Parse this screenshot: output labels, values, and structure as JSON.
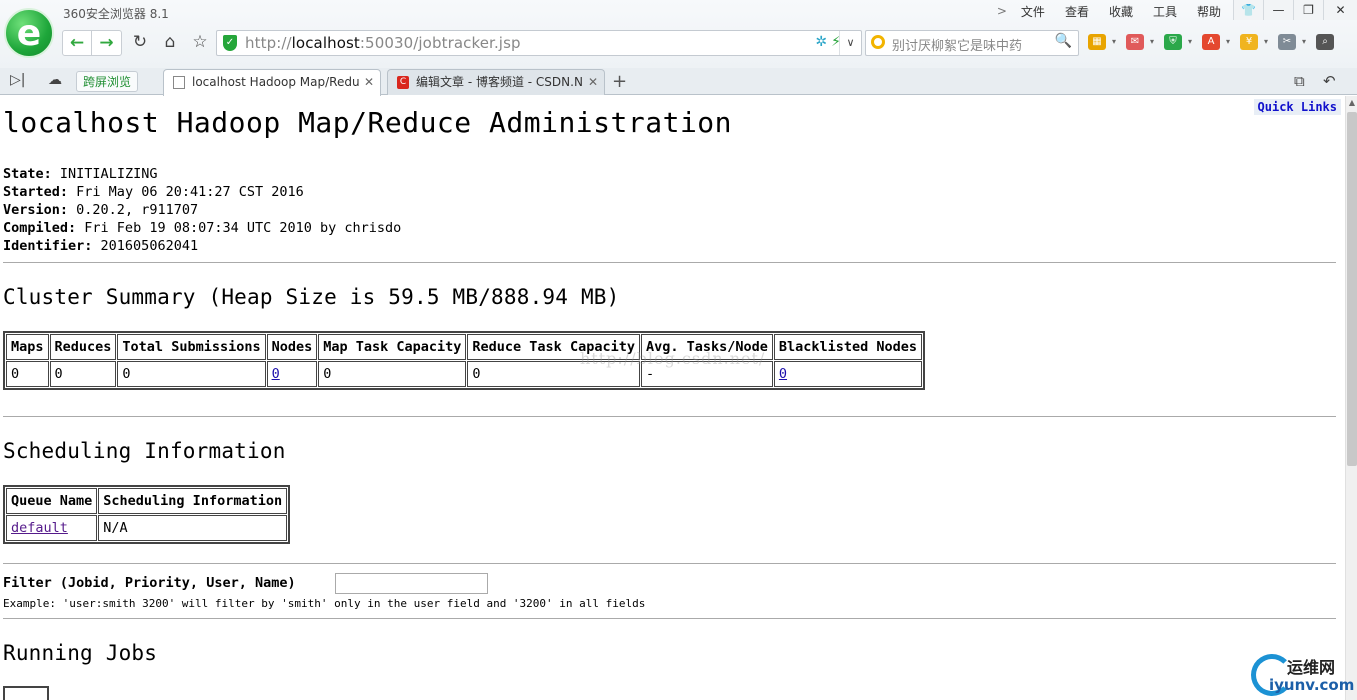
{
  "browser": {
    "title": "360安全浏览器 8.1",
    "logo_glyph": "e",
    "menu": [
      "文件",
      "查看",
      "收藏",
      "工具",
      "帮助"
    ],
    "menu_chevron": ">",
    "window_controls": {
      "skin": "👕",
      "minimize": "—",
      "maximize": "❐",
      "close": "✕"
    },
    "nav": {
      "back": "←",
      "forward": "→",
      "reload": "↻",
      "home": "⌂",
      "favorite": "☆"
    },
    "address": {
      "prefix": "http://",
      "host": "localhost",
      "rest": ":50030/jobtracker.jsp",
      "drop": "∨"
    },
    "search": {
      "placeholder": "别讨厌柳絮它是味中药",
      "glass": "🔍"
    },
    "extensions": [
      {
        "name": "apps",
        "glyph": "▦",
        "color": "#e8a400"
      },
      {
        "name": "mail",
        "glyph": "✉",
        "color": "#e05a5a"
      },
      {
        "name": "shield",
        "glyph": "⛨",
        "color": "#2ba84a"
      },
      {
        "name": "translate",
        "glyph": "A",
        "color": "#e4482f"
      },
      {
        "name": "wallet",
        "glyph": "¥",
        "color": "#f0b41f"
      },
      {
        "name": "screenshot",
        "glyph": "✂",
        "color": "#7f8b96"
      },
      {
        "name": "find",
        "glyph": "⌕",
        "color": "#555555"
      }
    ],
    "tabs": {
      "side_toggle": "▷|",
      "cloud": "☁",
      "split_label": "跨屏浏览",
      "items": [
        {
          "title": "localhost Hadoop Map/Redu",
          "active": true
        },
        {
          "title": "编辑文章 - 博客频道 - CSDN.N",
          "active": false
        }
      ],
      "close": "✕",
      "new_tab": "+",
      "restore": "⧉",
      "undo": "↶"
    }
  },
  "page": {
    "quick_links": "Quick Links",
    "title": "localhost Hadoop Map/Reduce Administration",
    "info": [
      {
        "label": "State:",
        "value": "INITIALIZING"
      },
      {
        "label": "Started:",
        "value": "Fri May 06 20:41:27 CST 2016"
      },
      {
        "label": "Version:",
        "value": "0.20.2, r911707"
      },
      {
        "label": "Compiled:",
        "value": "Fri Feb 19 08:07:34 UTC 2010 by chrisdo"
      },
      {
        "label": "Identifier:",
        "value": "201605062041"
      }
    ],
    "cluster_heading": "Cluster Summary (Heap Size is 59.5 MB/888.94 MB)",
    "cluster_table": {
      "headers": [
        "Maps",
        "Reduces",
        "Total Submissions",
        "Nodes",
        "Map Task Capacity",
        "Reduce Task Capacity",
        "Avg. Tasks/Node",
        "Blacklisted Nodes"
      ],
      "row": [
        "0",
        "0",
        "0",
        "0",
        "0",
        "0",
        "-",
        "0"
      ]
    },
    "scheduling_heading": "Scheduling Information",
    "scheduling_table": {
      "headers": [
        "Queue Name",
        "Scheduling Information"
      ],
      "row": [
        "default",
        "N/A"
      ]
    },
    "filter_label": "Filter (Jobid, Priority, User, Name)",
    "filter_value": "",
    "filter_example": "Example: 'user:smith 3200' will filter by 'smith' only in the user field and '3200' in all fields",
    "running_heading": "Running Jobs",
    "watermark": "http://blog.csdn.net/"
  },
  "site_logo": {
    "cn": "运维网",
    "en": "iyunv.com"
  }
}
